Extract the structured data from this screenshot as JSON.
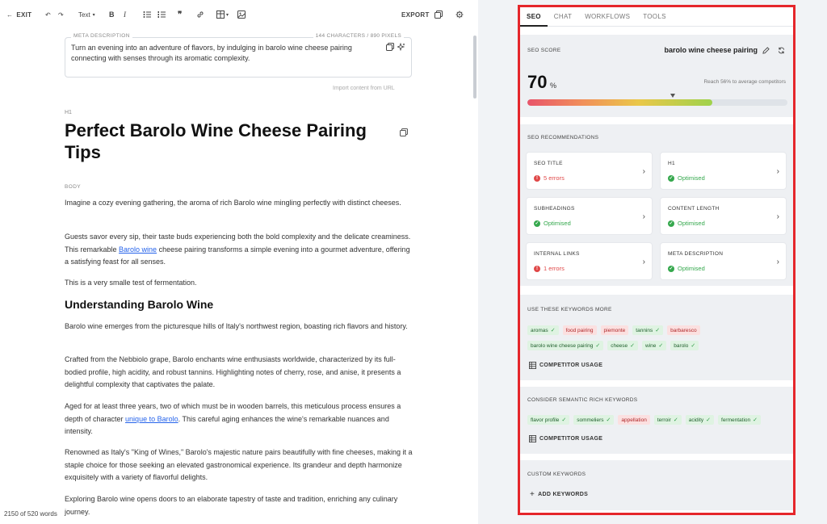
{
  "toolbar": {
    "exit_label": "EXIT",
    "text_style": "Text",
    "export_label": "EXPORT"
  },
  "meta": {
    "label": "META DESCRIPTION",
    "count": "144 CHARACTERS / 890 PIXELS",
    "text": "Turn an evening into an adventure of flavors, by indulging in barolo wine cheese pairing connecting with senses through its aromatic complexity.",
    "import_label": "Import content from URL"
  },
  "article": {
    "h1_tag": "H1",
    "title": "Perfect Barolo Wine Cheese Pairing Tips",
    "body_tag": "BODY",
    "p1": "Imagine a cozy evening gathering, the aroma of rich Barolo wine mingling perfectly with distinct cheeses.",
    "p2_a": "Guests savor every sip, their taste buds experiencing both the bold complexity and the delicate creaminess. This remarkable ",
    "p2_link": "Barolo wine",
    "p2_b": " cheese pairing transforms a simple evening into a gourmet adventure, offering a satisfying feast for all senses.",
    "p3": "This is a very smalle test of fermentation.",
    "h2": "Understanding Barolo Wine",
    "p4": "Barolo wine emerges from the picturesque hills of Italy's northwest region, boasting rich flavors and history.",
    "p5": "Crafted from the Nebbiolo grape, Barolo enchants wine enthusiasts worldwide, characterized by its full-bodied profile, high acidity, and robust tannins. Highlighting notes of cherry, rose, and anise, it presents a delightful complexity that captivates the palate.",
    "p6_a": "Aged for at least three years, two of which must be in wooden barrels, this meticulous process ensures a depth of character ",
    "p6_link": "unique to Barolo",
    "p6_b": ". This careful aging enhances the wine's remarkable nuances and intensity.",
    "p7": "Renowned as Italy's \"King of Wines,\" Barolo's majestic nature pairs beautifully with fine cheeses, making it a staple choice for those seeking an elevated gastronomical experience. Its grandeur and depth harmonize exquisitely with a variety of flavorful delights.",
    "p8": "Exploring Barolo wine opens doors to an elaborate tapestry of taste and tradition, enriching any culinary journey.",
    "word_count": "2150 of 520 words"
  },
  "panel": {
    "tabs": [
      "SEO",
      "CHAT",
      "WORKFLOWS",
      "TOOLS"
    ],
    "score": {
      "label": "SEO SCORE",
      "keyword": "barolo wine cheese pairing",
      "value": "70",
      "unit": "%",
      "reach": "Reach 56% to average competitors",
      "fill_fraction": 0.71,
      "marker_fraction": 0.56
    },
    "recommendations": {
      "label": "SEO RECOMMENDATIONS",
      "cards": [
        {
          "title": "SEO TITLE",
          "status": "5 errors",
          "state": "err"
        },
        {
          "title": "H1",
          "status": "Optimised",
          "state": "ok"
        },
        {
          "title": "SUBHEADINGS",
          "status": "Optimised",
          "state": "ok"
        },
        {
          "title": "CONTENT LENGTH",
          "status": "Optimised",
          "state": "ok"
        },
        {
          "title": "INTERNAL LINKS",
          "status": "1 errors",
          "state": "err"
        },
        {
          "title": "META DESCRIPTION",
          "status": "Optimised",
          "state": "ok"
        }
      ]
    },
    "keywords_more": {
      "label": "USE THESE KEYWORDS MORE",
      "row1": [
        {
          "text": "aromas",
          "state": "ok"
        },
        {
          "text": "food pairing",
          "state": "bad"
        },
        {
          "text": "piemonte",
          "state": "bad"
        },
        {
          "text": "tannins",
          "state": "ok"
        },
        {
          "text": "barbaresco",
          "state": "bad"
        }
      ],
      "row2": [
        {
          "text": "barolo wine cheese pairing",
          "state": "ok"
        },
        {
          "text": "cheese",
          "state": "ok"
        },
        {
          "text": "wine",
          "state": "ok"
        },
        {
          "text": "barolo",
          "state": "ok"
        }
      ],
      "competitor_label": "COMPETITOR USAGE"
    },
    "semantic": {
      "label": "CONSIDER SEMANTIC RICH KEYWORDS",
      "row1": [
        {
          "text": "flavor profile",
          "state": "ok"
        },
        {
          "text": "sommeliers",
          "state": "ok"
        },
        {
          "text": "appellation",
          "state": "bad"
        },
        {
          "text": "terroir",
          "state": "ok"
        },
        {
          "text": "acidity",
          "state": "ok"
        },
        {
          "text": "fermentation",
          "state": "ok"
        }
      ],
      "competitor_label": "COMPETITOR USAGE"
    },
    "custom": {
      "label": "CUSTOM KEYWORDS",
      "add_label": "ADD KEYWORDS"
    }
  },
  "colors": {
    "highlight_border": "#e5262b",
    "ok": "#35a84d",
    "error": "#e04848",
    "link": "#2563eb"
  }
}
